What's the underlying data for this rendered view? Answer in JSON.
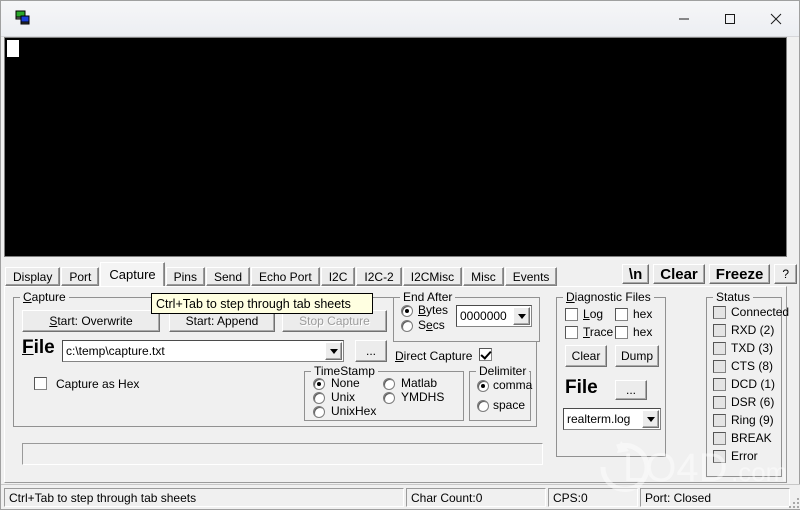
{
  "window": {
    "title": "",
    "icon": "realterm-icon",
    "controls": {
      "minimize": "—",
      "maximize": "□",
      "close": "✕"
    }
  },
  "terminal": {
    "content": "",
    "cursor": "block-cursor"
  },
  "tabs": [
    {
      "label": "Display",
      "active": false
    },
    {
      "label": "Port",
      "active": false
    },
    {
      "label": "Capture",
      "active": true
    },
    {
      "label": "Pins",
      "active": false
    },
    {
      "label": "Send",
      "active": false
    },
    {
      "label": "Echo Port",
      "active": false
    },
    {
      "label": "I2C",
      "active": false
    },
    {
      "label": "I2C-2",
      "active": false
    },
    {
      "label": "I2CMisc",
      "active": false
    },
    {
      "label": "Misc",
      "active": false
    },
    {
      "label": "Events",
      "active": false
    }
  ],
  "toolbar": {
    "newline_label": "\\n",
    "clear_label": "Clear",
    "freeze_label": "Freeze",
    "help_label": "?"
  },
  "tooltip": {
    "text": "Ctrl+Tab to step through tab sheets"
  },
  "capture_group": {
    "legend": "Capture",
    "start_overwrite": "Start: Overwrite",
    "start_append": "Start: Append",
    "stop_capture": "Stop Capture",
    "stop_capture_disabled": true,
    "file_label": "File",
    "file_value": "c:\\temp\\capture.txt",
    "browse_label": "...",
    "capture_as_hex_label": "Capture as Hex",
    "capture_as_hex_checked": false
  },
  "timestamp_group": {
    "legend": "TimeStamp",
    "options": [
      "None",
      "Unix",
      "UnixHex",
      "Matlab",
      "YMDHS"
    ],
    "selected": "None"
  },
  "delimiter_group": {
    "legend": "Delimiter",
    "options": [
      "comma",
      "space"
    ],
    "selected": "comma"
  },
  "end_after_group": {
    "legend": "End After",
    "options": [
      "Bytes",
      "Secs"
    ],
    "selected": "Bytes",
    "count_value": "0000000",
    "direct_capture_label": "Direct Capture",
    "direct_capture_checked": true
  },
  "diagnostic_group": {
    "legend": "Diagnostic Files",
    "log_label": "Log",
    "log_checked": false,
    "log_hex_label": "hex",
    "log_hex_checked": false,
    "trace_label": "Trace",
    "trace_checked": false,
    "trace_hex_label": "hex",
    "trace_hex_checked": false,
    "clear_label": "Clear",
    "dump_label": "Dump",
    "file_label": "File",
    "browse_label": "...",
    "file_value": "realterm.log"
  },
  "status_group": {
    "legend": "Status",
    "items": [
      {
        "label": "Connected",
        "on": false
      },
      {
        "label": "RXD (2)",
        "on": false
      },
      {
        "label": "TXD (3)",
        "on": false
      },
      {
        "label": "CTS (8)",
        "on": false
      },
      {
        "label": "DCD (1)",
        "on": false
      },
      {
        "label": "DSR (6)",
        "on": false
      },
      {
        "label": "Ring (9)",
        "on": false
      },
      {
        "label": "BREAK",
        "on": false
      },
      {
        "label": "Error",
        "on": false
      }
    ]
  },
  "statusbar": {
    "hint": "Ctrl+Tab to step through tab sheets",
    "char_count": "Char Count:0",
    "cps": "CPS:0",
    "port": "Port: Closed"
  },
  "watermark": {
    "text": "LO4D.com"
  }
}
